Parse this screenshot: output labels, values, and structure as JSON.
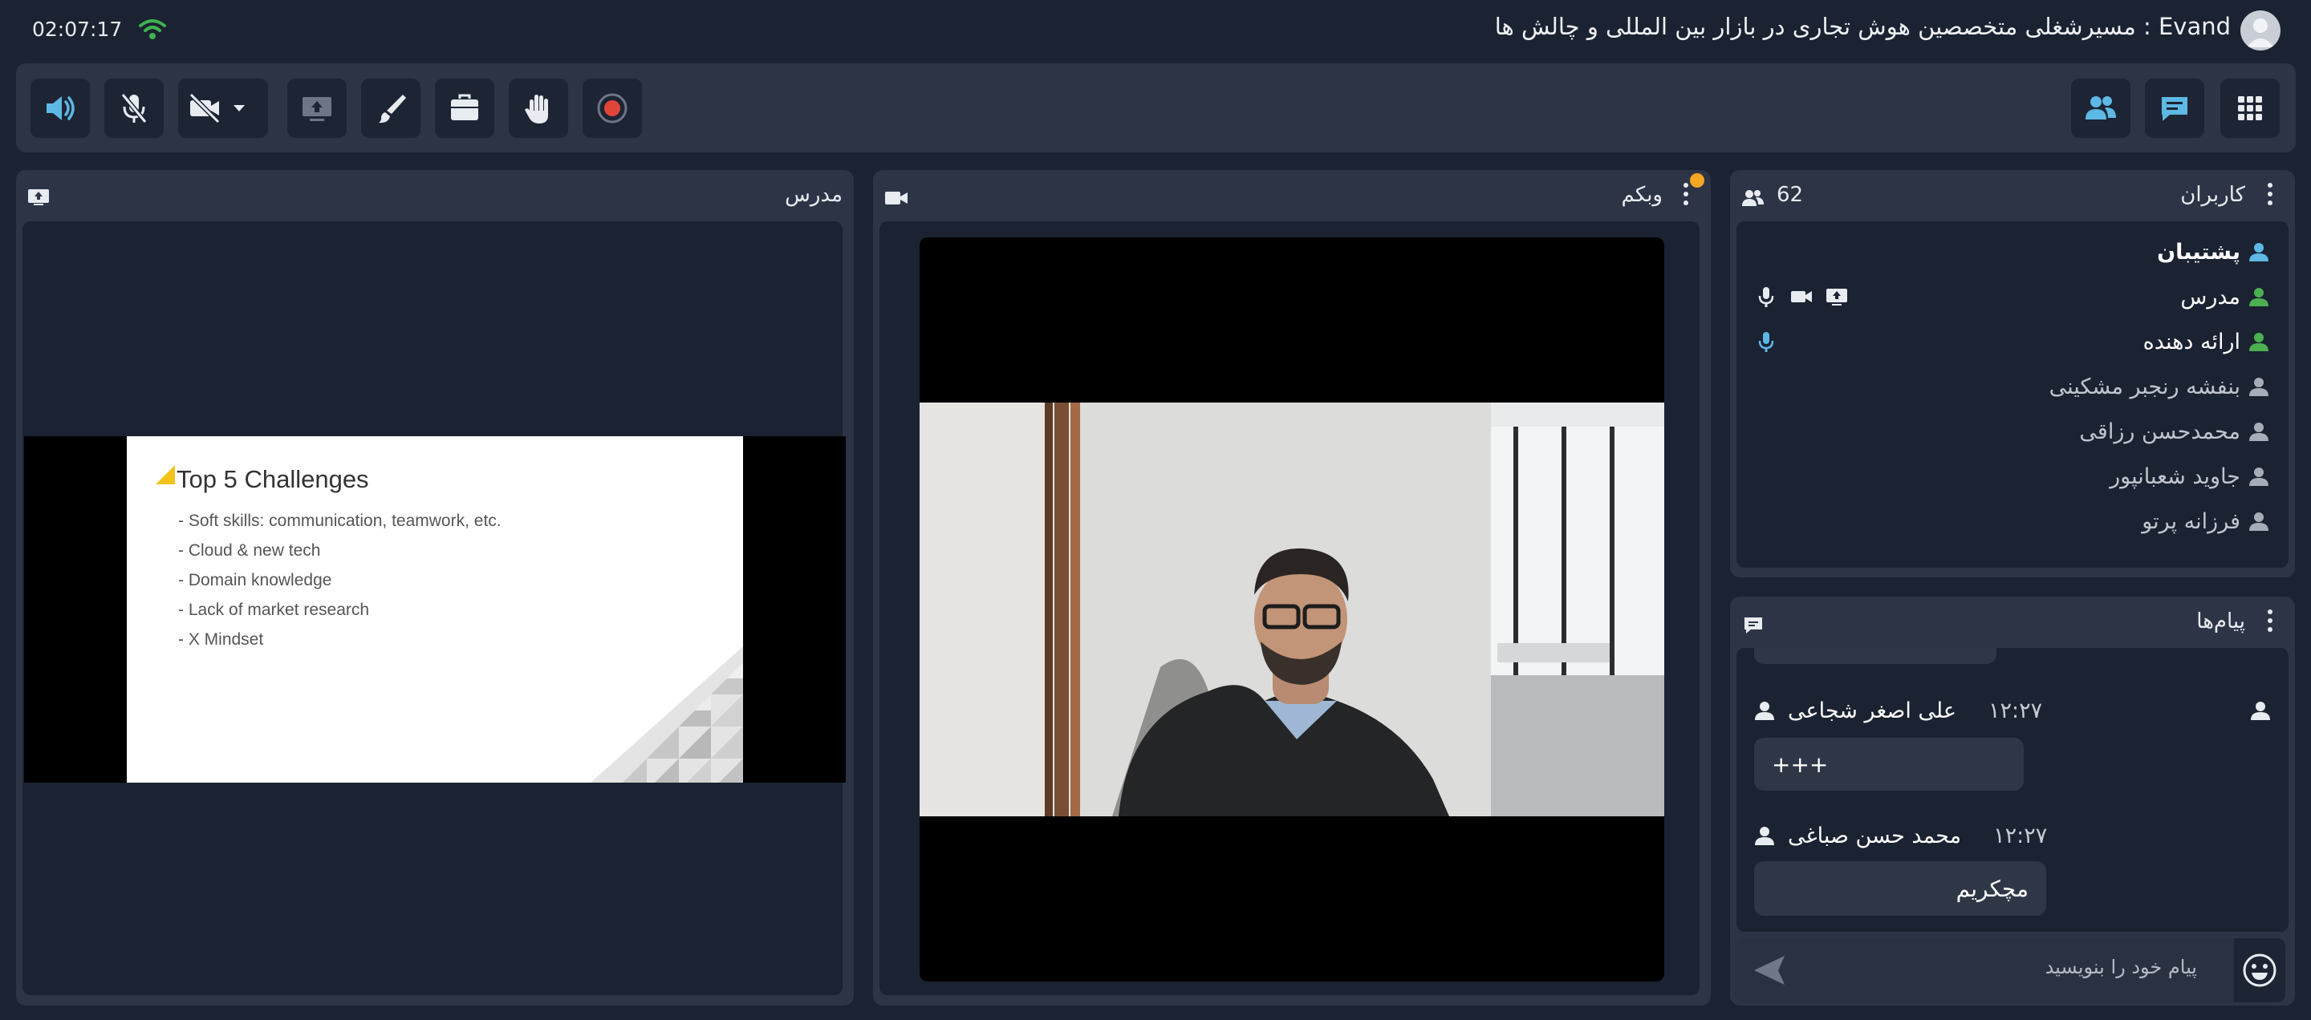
{
  "topbar": {
    "clock": "02:07:17",
    "title": "Evand : مسیرشغلی متخصصین هوش تجاری در بازار بین المللی و چالش ها"
  },
  "toolbar": {
    "left_buttons": [
      "speaker-icon",
      "mic-muted-icon",
      "camera-off-icon",
      "share-screen-icon",
      "brush-icon",
      "briefcase-icon",
      "raise-hand-icon",
      "record-icon"
    ],
    "right_buttons": [
      "users-icon",
      "chat-icon",
      "apps-grid-icon"
    ]
  },
  "presenter_panel": {
    "title": "مدرس",
    "slide": {
      "title": "Top 5 Challenges",
      "bullets": [
        "-  Soft skills: communication, teamwork, etc.",
        "-  Cloud & new tech",
        "-  Domain knowledge",
        "-  Lack of market research",
        "-  X Mindset"
      ]
    }
  },
  "webcam_panel": {
    "title": "وبکم"
  },
  "users_panel": {
    "title": "کاربران",
    "count": "62",
    "users": [
      {
        "name": "پشتیبان",
        "role": "support"
      },
      {
        "name": "مدرس",
        "role": "teacher"
      },
      {
        "name": "ارائه دهنده",
        "role": "presenter"
      },
      {
        "name": "بنفشه رنجبر مشکینی",
        "role": "attendee"
      },
      {
        "name": "محمدحسن رزاقی",
        "role": "attendee"
      },
      {
        "name": "جاوید شعبانپور",
        "role": "attendee"
      },
      {
        "name": "فرزانه پرتو",
        "role": "attendee"
      }
    ]
  },
  "messages_panel": {
    "title": "پیام‌ها",
    "messages": [
      {
        "sender": "علی اصغر شجاعی",
        "time": "۱۲:۲۷",
        "text": "+++"
      },
      {
        "sender": "محمد حسن صباغی",
        "time": "۱۲:۲۷",
        "text": "مچکریم"
      }
    ],
    "input_placeholder": "پیام خود را بنویسید"
  },
  "colors": {
    "background": "#1b2231",
    "panel": "#2c3446",
    "accent_blue": "#5db8e6",
    "online_green": "#4caf50",
    "notification_orange": "#f5a623",
    "record_red": "#e0453a"
  }
}
